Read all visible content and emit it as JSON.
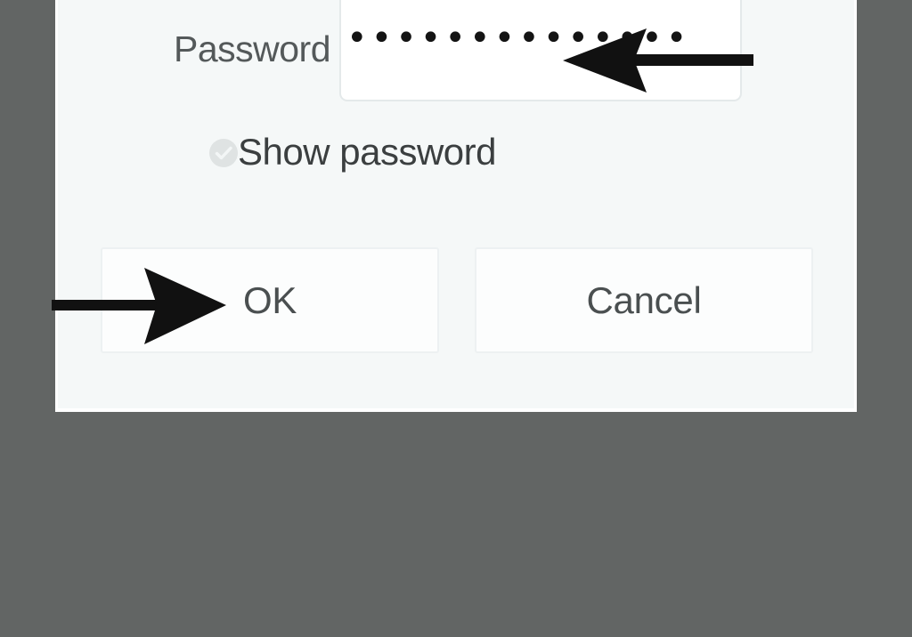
{
  "window": {
    "backdrop_color": "#626564",
    "dialog_background": "#f5f8f8"
  },
  "dialog": {
    "password_field": {
      "label": "Password",
      "masked_value": "••••••••••••••",
      "dot_count": 14,
      "input_background": "#ffffff",
      "border_color": "#e4e9ea"
    },
    "show_password": {
      "label": "Show password",
      "checkbox_icon": "check-circle-icon",
      "checked": false,
      "icon_color": "#d8dcdc"
    },
    "buttons": {
      "ok_label": "OK",
      "cancel_label": "Cancel",
      "button_background": "#fcfdfd",
      "button_border": "#edf1f2",
      "text_color": "#4a4f50"
    }
  },
  "annotations": {
    "arrow_color": "#111111",
    "arrow_to_password_field": {
      "icon": "arrow-left-icon",
      "direction": "left",
      "points_at": "Password"
    },
    "arrow_to_ok_button": {
      "icon": "arrow-right-icon",
      "direction": "right",
      "points_at": "OK"
    }
  }
}
